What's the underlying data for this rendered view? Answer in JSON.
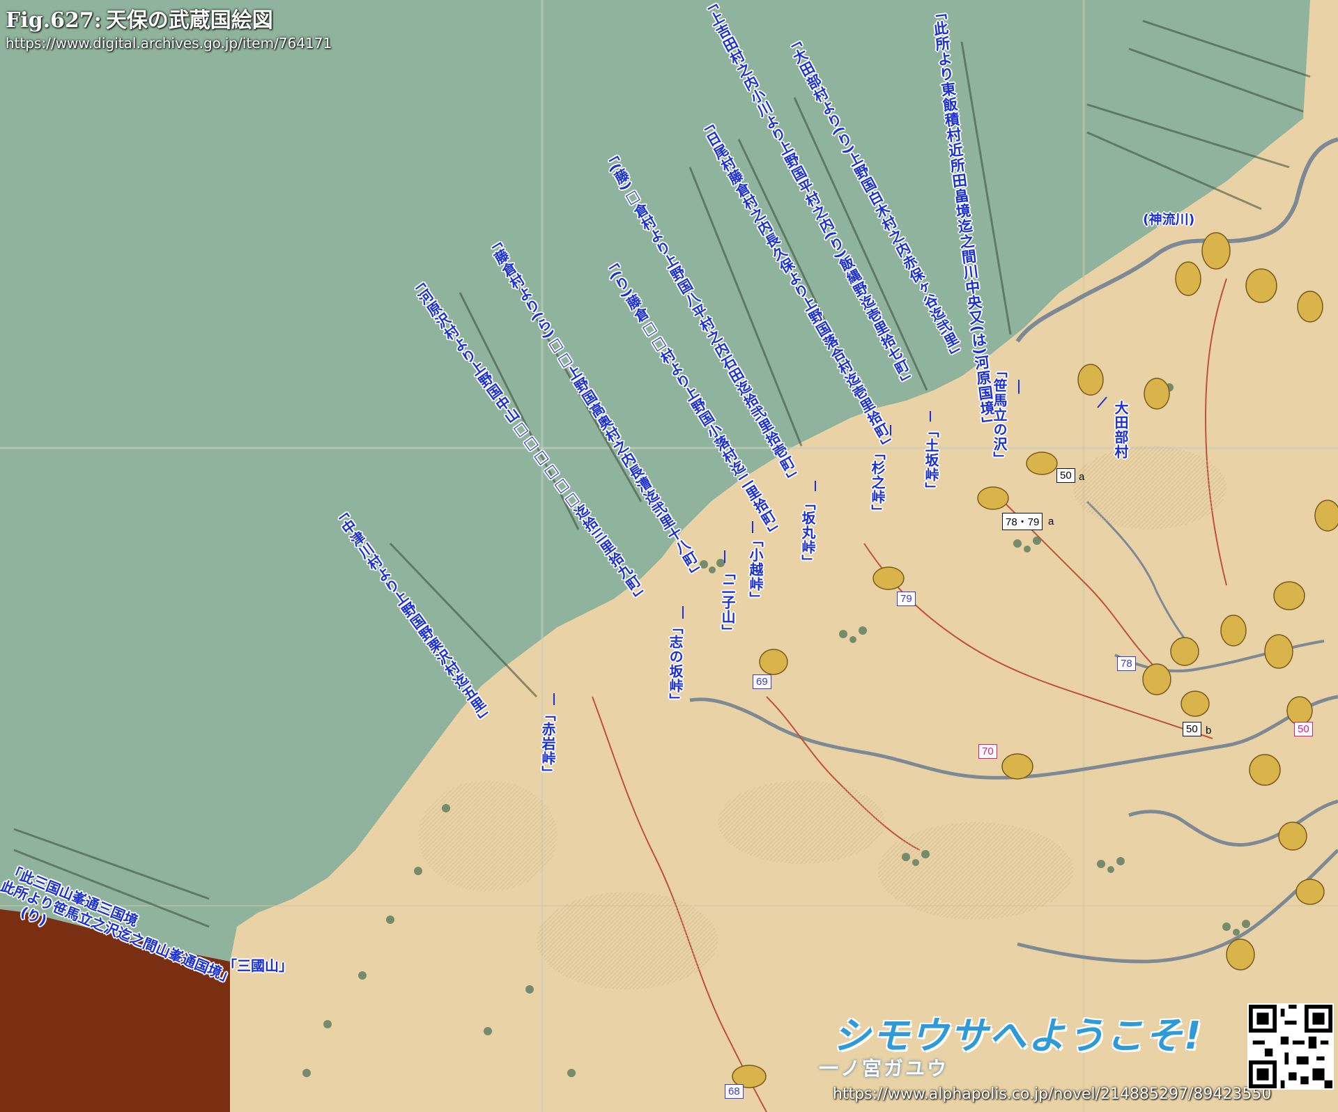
{
  "header": {
    "fig_number": "Fig.627:",
    "title": "天保の武蔵国絵図",
    "source_url": "https://www.digital.archives.go.jp/item/764171"
  },
  "colors": {
    "sea_green": "#8fb39c",
    "land": "#e9d3a6",
    "neighbor_province": "#7a2e12",
    "label_blue": "#1a2fd8",
    "river": "#7d8a96",
    "road": "#c0503a",
    "village_oval": "#d8b44a",
    "route_pink": "#d91a8c"
  },
  "labels": {
    "right_border_a": "「此所より東飯積村近所田畠境迄之間川中央又(は)河原国境」",
    "kaminaga": "「上吉田村之内小川より上野国平村之内(り)飯縄野迄壱里拾七町」",
    "ota_tsurugi": "「大田部村より(り)上野国白木村之内赤保ヶ谷迄弐里」",
    "hitoku_a": "「日尾村藤倉村之内長久保より上野国落合村迄壱里拾町」",
    "koikura": "「(藤)□倉村より上野国八平村之内石田迄拾弐里拾壱町」",
    "nobori": "「(り)藤倉□□村より上野国小落村迄二里拾町」",
    "fujikura": "「藤倉村より(ら)□□上野国高奥村之内長漕迄弐里十八町」",
    "kawachi": "「河原沢村より上野国中山□□□□□□迄拾三里拾九町」",
    "nakatsugawa": "「中津川村より上野国野栗沢村迄五里」",
    "sasamatachi": "「笹馬立の沢」",
    "otabe": "大田部村",
    "dozaka": "「土坂峠」",
    "shogi": "「杉之峠」",
    "sakakyu": "「坂丸峠」",
    "kogoe": "「小越峠」",
    "futago": "「二子山」",
    "shinosaka": "「志の坂峠」",
    "akaiwa": "「赤岩峠」",
    "mikuni": "「三國山」",
    "kannagawa": "(神流川)",
    "sangoku_line1": "「此三国山峯通三国境",
    "sangoku_line2": "此所より笹馬立之沢迄之間山峯通国境」",
    "sangoku_line3": "(り)"
  },
  "markers": {
    "m50a": "50",
    "m50a_suffix": "a",
    "m7879a": "78・79",
    "m7879a_suffix": "a",
    "m79": "79",
    "m78": "78",
    "m50b": "50",
    "m50b_suffix": "b",
    "m50pink": "50",
    "m70": "70",
    "m69": "69",
    "m68": "68"
  },
  "footer": {
    "banner": "シモウサへようこそ!",
    "brand": "一ノ宮ガユウ",
    "url": "https://www.alphapolis.co.jp/novel/214885297/89423550"
  }
}
